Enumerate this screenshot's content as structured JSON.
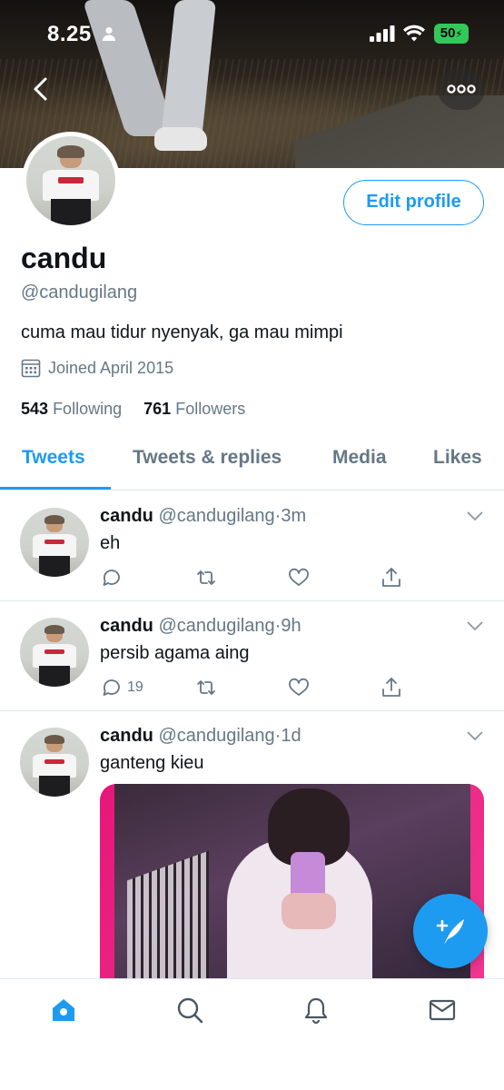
{
  "status_bar": {
    "time": "8.25",
    "battery": "50"
  },
  "profile": {
    "name": "candu",
    "handle": "@candugilang",
    "bio": "cuma mau tidur nyenyak, ga mau mimpi",
    "joined": "Joined April 2015",
    "following_count": "543",
    "following_label": "Following",
    "followers_count": "761",
    "followers_label": "Followers",
    "edit_label": "Edit profile"
  },
  "tabs": [
    {
      "label": "Tweets",
      "active": true
    },
    {
      "label": "Tweets & replies",
      "active": false
    },
    {
      "label": "Media",
      "active": false
    },
    {
      "label": "Likes",
      "active": false
    }
  ],
  "tweets": [
    {
      "name": "candu",
      "handle": "@candugilang",
      "sep": "·",
      "time": "3m",
      "text": "eh",
      "replies": ""
    },
    {
      "name": "candu",
      "handle": "@candugilang",
      "sep": "·",
      "time": "9h",
      "text": "persib agama aing",
      "replies": "19"
    },
    {
      "name": "candu",
      "handle": "@candugilang",
      "sep": "·",
      "time": "1d",
      "text": "ganteng kieu",
      "replies": ""
    }
  ],
  "icons": {
    "back": "chevron-left-icon",
    "more": "ellipsis-icon",
    "calendar": "calendar-icon",
    "compose": "compose-feather-icon",
    "nav": [
      "home-icon",
      "search-icon",
      "bell-icon",
      "mail-icon"
    ]
  },
  "colors": {
    "accent": "#1d9bf0",
    "muted": "#657786",
    "battery": "#34c759"
  }
}
